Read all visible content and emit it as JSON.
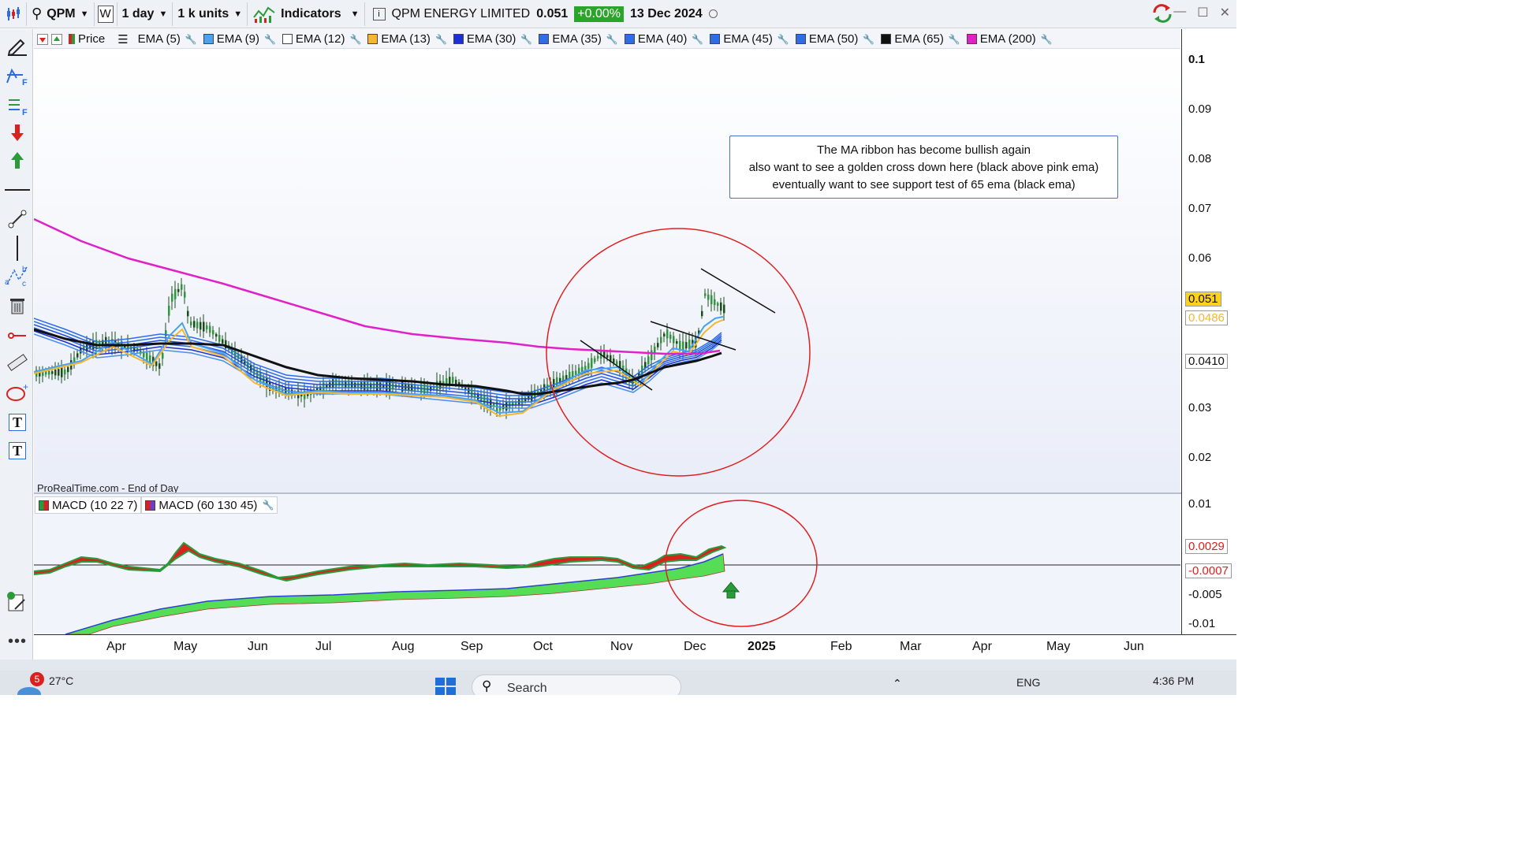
{
  "toolbar": {
    "symbol": "QPM",
    "period_code": "W",
    "timeframe": "1 day",
    "units": "1 k units",
    "indicators": "Indicators",
    "instrument": "QPM ENERGY LIMITED",
    "last_price": "0.051",
    "change": "+0.00%",
    "date": "13 Dec 2024"
  },
  "legend": [
    {
      "label": "Price",
      "color": "#2e9e2e"
    },
    {
      "label": "EMA (5)",
      "color": "#ffffff"
    },
    {
      "label": "EMA (9)",
      "color": "#4aa3f0"
    },
    {
      "label": "EMA (12)",
      "color": "#ffffff"
    },
    {
      "label": "EMA (13)",
      "color": "#f5b730"
    },
    {
      "label": "EMA (30)",
      "color": "#1a2fd6"
    },
    {
      "label": "EMA (35)",
      "color": "#2f6de8"
    },
    {
      "label": "EMA (40)",
      "color": "#2f6de8"
    },
    {
      "label": "EMA (45)",
      "color": "#2f6de8"
    },
    {
      "label": "EMA (50)",
      "color": "#2f6de8"
    },
    {
      "label": "EMA (65)",
      "color": "#111111"
    },
    {
      "label": "EMA (200)",
      "color": "#e020c8"
    }
  ],
  "watermark": "ProRealTime.com - End of Day",
  "annotation": {
    "line1": "The MA ribbon has become bullish again",
    "line2": "also want to see a golden cross down here (black above pink ema)",
    "line3": "eventually want to see support test of 65 ema (black ema)"
  },
  "macd_legend": [
    {
      "label": "MACD (10 22 7)",
      "color": "#d9221f"
    },
    {
      "label": "MACD (60 130 45)",
      "color": "#6b3fd0"
    }
  ],
  "yaxis": {
    "price_ticks": [
      "0.1",
      "0.09",
      "0.08",
      "0.07",
      "0.06",
      "0.03",
      "0.02"
    ],
    "price_labels": [
      {
        "text": "0.051",
        "bg": "#ffd21a",
        "fg": "#111111"
      },
      {
        "text": "0.0486",
        "bg": "#ffffff",
        "fg": "#f5b730"
      },
      {
        "text": "0.0410",
        "bg": "#ffffff",
        "fg": "#111111"
      }
    ],
    "macd_ticks": [
      "0.01",
      "-0.005",
      "-0.01"
    ],
    "macd_labels": [
      {
        "text": "0.0029",
        "bg": "#ffffff",
        "fg": "#d9221f"
      },
      {
        "text": "-0.0007",
        "bg": "#ffffff",
        "fg": "#d9221f"
      }
    ]
  },
  "xaxis": [
    "Apr",
    "May",
    "Jun",
    "Jul",
    "Aug",
    "Sep",
    "Oct",
    "Nov",
    "Dec",
    "2025",
    "Feb",
    "Mar",
    "Apr",
    "May",
    "Jun"
  ],
  "taskbar": {
    "weather_temp": "27°C",
    "notification_count": "5",
    "search_placeholder": "Search",
    "language": "ENG",
    "time": "4:36 PM"
  }
}
